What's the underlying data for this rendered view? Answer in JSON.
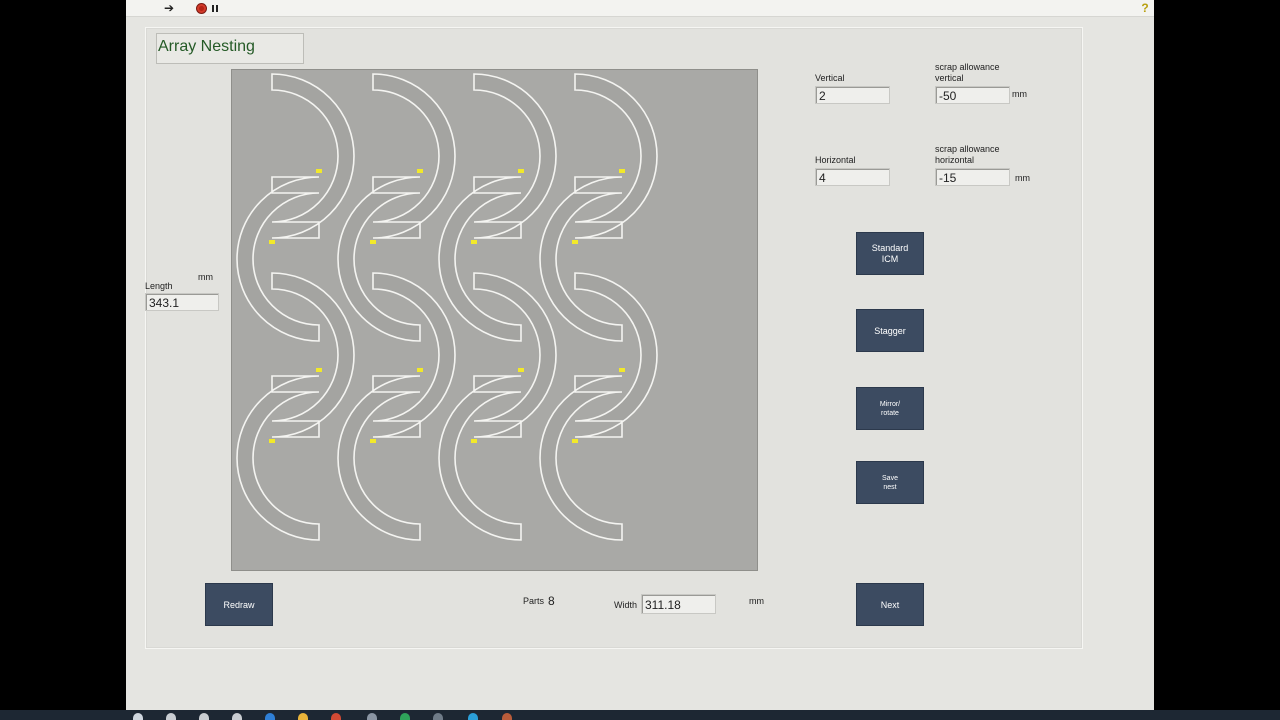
{
  "title": "Array Nesting",
  "vertical": {
    "label": "Vertical",
    "value": "2"
  },
  "horizontal": {
    "label": "Horizontal",
    "value": "4"
  },
  "scrap_vertical": {
    "label_line1": "scrap allowance",
    "label_line2": "vertical",
    "value": "-50",
    "unit": "mm"
  },
  "scrap_horizontal": {
    "label_line1": "scrap allowance",
    "label_line2": "horizontal",
    "value": "-15",
    "unit": "mm"
  },
  "length": {
    "label": "Length",
    "unit": "mm",
    "value": "343.1"
  },
  "width": {
    "label": "Width",
    "value": "311.18",
    "unit": "mm"
  },
  "parts": {
    "label": "Parts",
    "value": "8"
  },
  "buttons": {
    "standard_icm": "Standard\nICM",
    "stagger": "Stagger",
    "mirror_rotate": "Mirror/\nrotate",
    "save_nest": "Save\nnest",
    "redraw": "Redraw",
    "next": "Next"
  },
  "nest": {
    "columns": 4,
    "rows": 2
  },
  "colors": {
    "canvas": "#a9a9a6",
    "button": "#3c4b61",
    "title_text": "#245a26",
    "marker": "#f2e92a"
  },
  "icons": [
    "step-icon",
    "record-icon",
    "pause-icon",
    "help-icon"
  ]
}
